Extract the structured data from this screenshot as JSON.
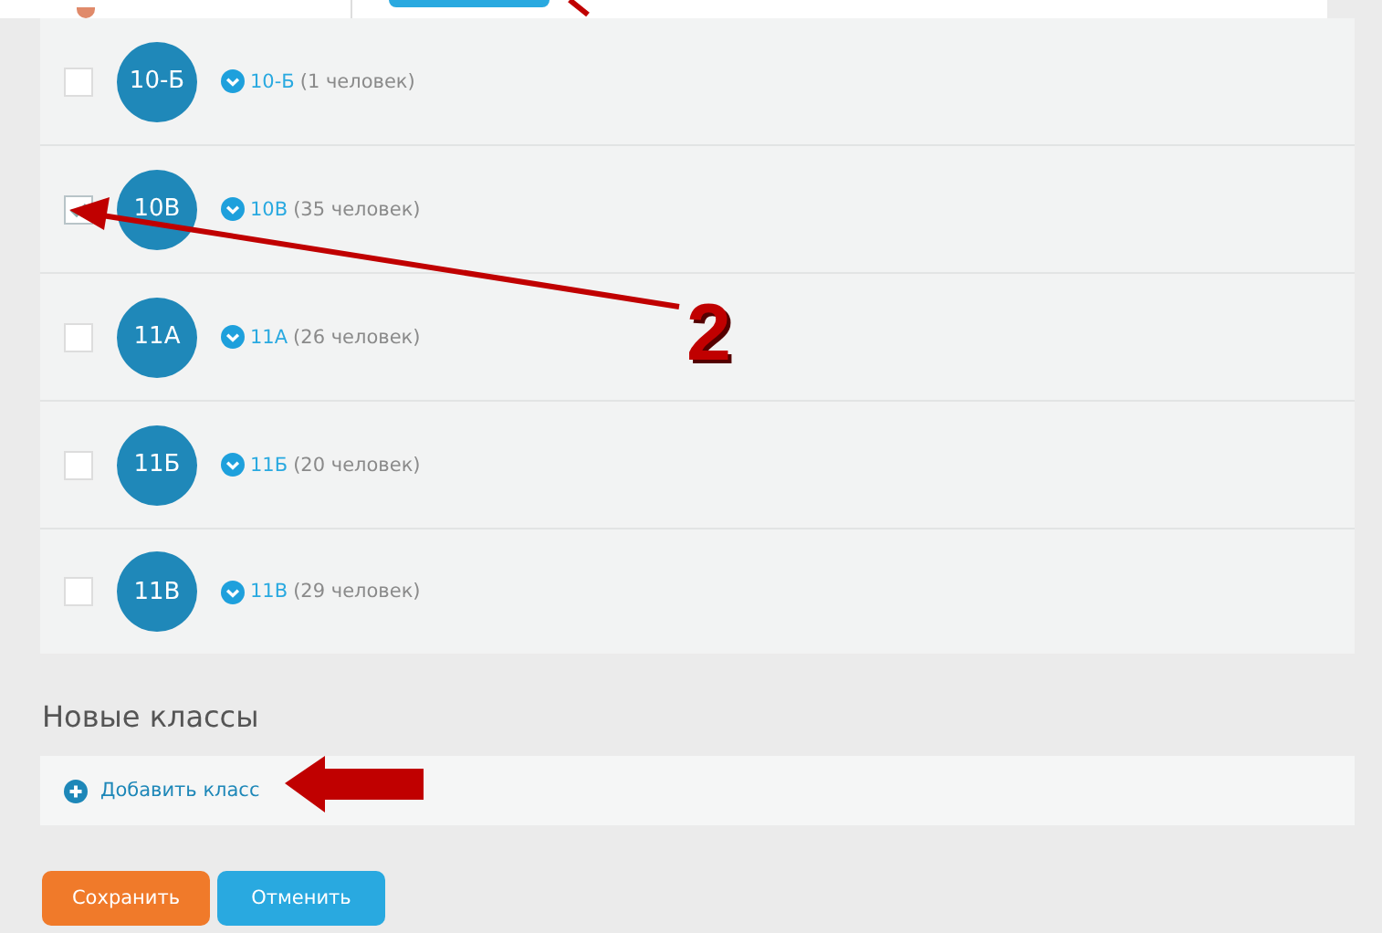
{
  "classes": [
    {
      "badge": "10-Б",
      "name": "10-Б",
      "count": "(1 человек)",
      "checked": false
    },
    {
      "badge": "10В",
      "name": "10В",
      "count": "(35 человек)",
      "checked": true
    },
    {
      "badge": "11А",
      "name": "11А",
      "count": "(26 человек)",
      "checked": false
    },
    {
      "badge": "11Б",
      "name": "11Б",
      "count": "(20 человек)",
      "checked": false
    },
    {
      "badge": "11В",
      "name": "11В",
      "count": "(29 человек)",
      "checked": false
    }
  ],
  "new_classes": {
    "title": "Новые классы",
    "add_link": "Добавить класс"
  },
  "buttons": [
    {
      "label": "Сохранить",
      "kind": "save"
    },
    {
      "label": "Отменить",
      "kind": "cancel"
    }
  ],
  "annotation": {
    "number": "2"
  }
}
